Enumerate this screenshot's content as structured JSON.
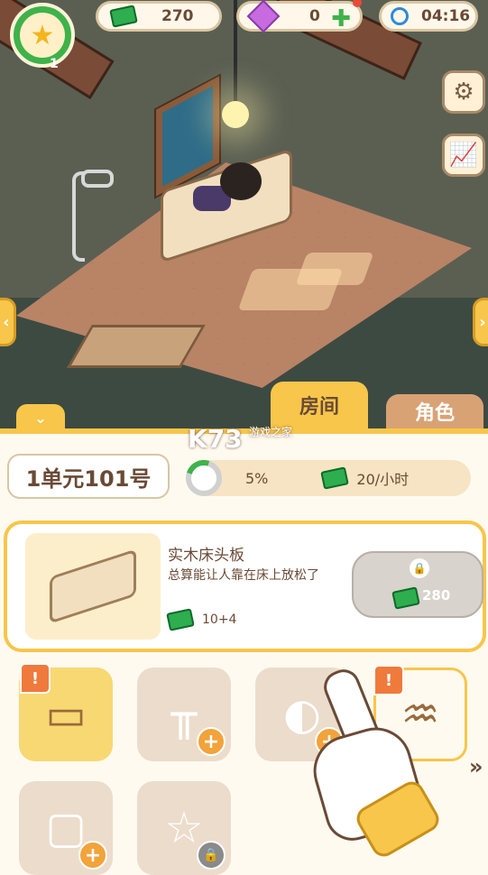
{
  "hud": {
    "level": "1",
    "cash": "270",
    "gems": "0",
    "time": "04:16"
  },
  "tabs": {
    "room": "房间",
    "character": "角色"
  },
  "watermark": {
    "logo": "K73",
    "sub": "游戏之家"
  },
  "room_info": {
    "name": "1单元101号",
    "progress_percent": 5,
    "progress_label": "5%",
    "income": "20/小时"
  },
  "item": {
    "name": "实木床头板",
    "description": "总算能让人靠在床上放松了",
    "bonus": "10+4",
    "price": "280"
  },
  "slots": [
    {
      "name": "bed",
      "state": "active",
      "notice": "!"
    },
    {
      "name": "desk",
      "state": "add"
    },
    {
      "name": "toilet",
      "state": "add"
    },
    {
      "name": "shower",
      "state": "active",
      "notice": "!"
    },
    {
      "name": "tv",
      "state": "add"
    },
    {
      "name": "lamp",
      "state": "locked"
    }
  ],
  "colors": {
    "accent": "#f7c64a",
    "cash_green": "#2fae4f",
    "panel_bg": "#fffaf0",
    "tab_inactive": "#d9a275"
  }
}
